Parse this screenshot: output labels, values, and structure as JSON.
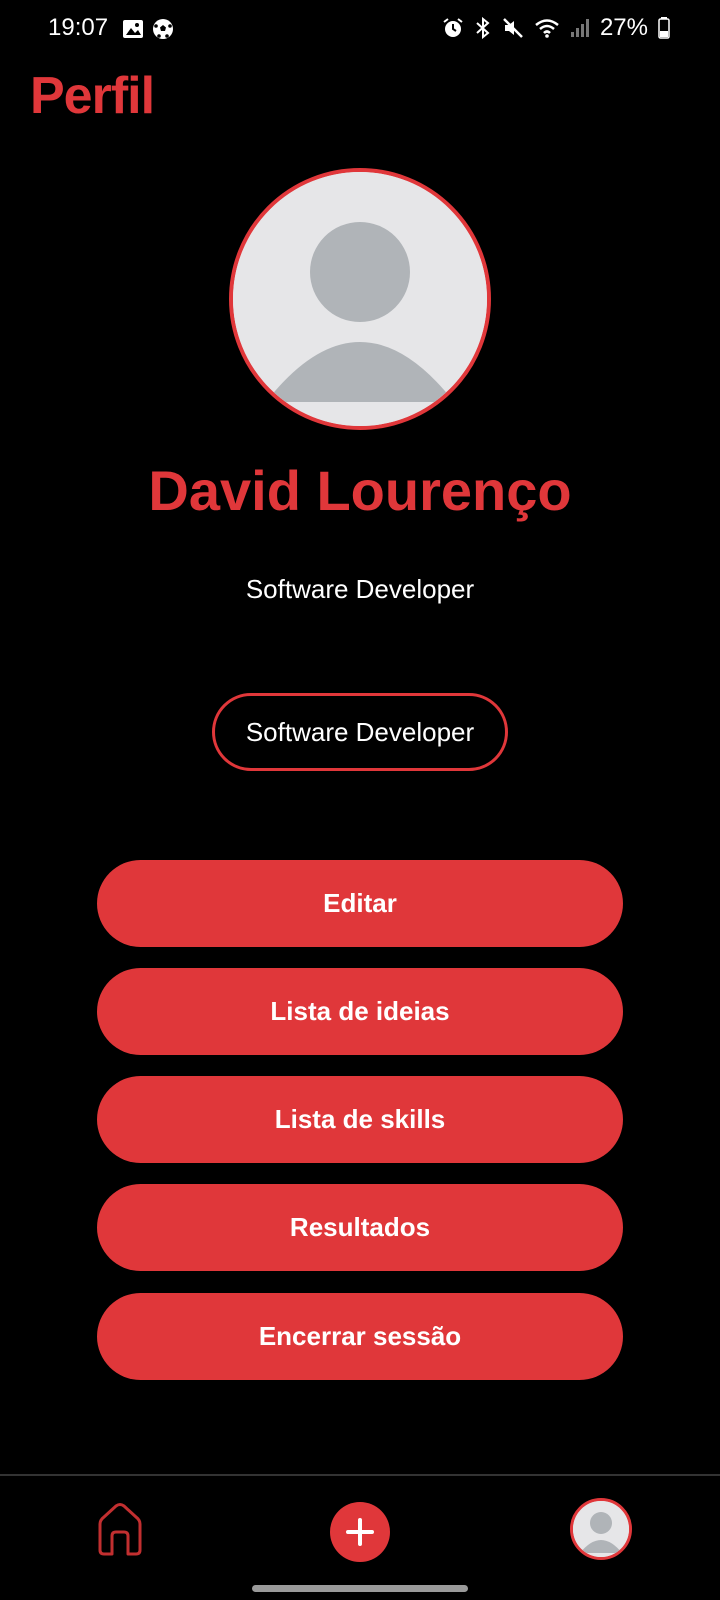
{
  "status_bar": {
    "time": "19:07",
    "battery": "27%",
    "icons_left": [
      "image-icon",
      "soccer-ball-icon"
    ],
    "icons_right": [
      "alarm-icon",
      "bluetooth-icon",
      "mute-icon",
      "wifi-icon",
      "signal-icon",
      "battery-icon"
    ]
  },
  "header": {
    "title": "Perfil"
  },
  "profile": {
    "name": "David Lourenço",
    "role": "Software Developer",
    "chip": "Software Developer"
  },
  "menu": {
    "edit": "Editar",
    "ideas": "Lista de ideias",
    "skills": "Lista de skills",
    "results": "Resultados",
    "logout": "Encerrar sessão"
  },
  "nav": {
    "items": [
      "home-icon",
      "add-icon",
      "profile-avatar"
    ]
  },
  "colors": {
    "accent": "#e0373a",
    "background": "#000000",
    "avatar_bg": "#e6e6e8",
    "avatar_fg": "#b0b4b8"
  }
}
